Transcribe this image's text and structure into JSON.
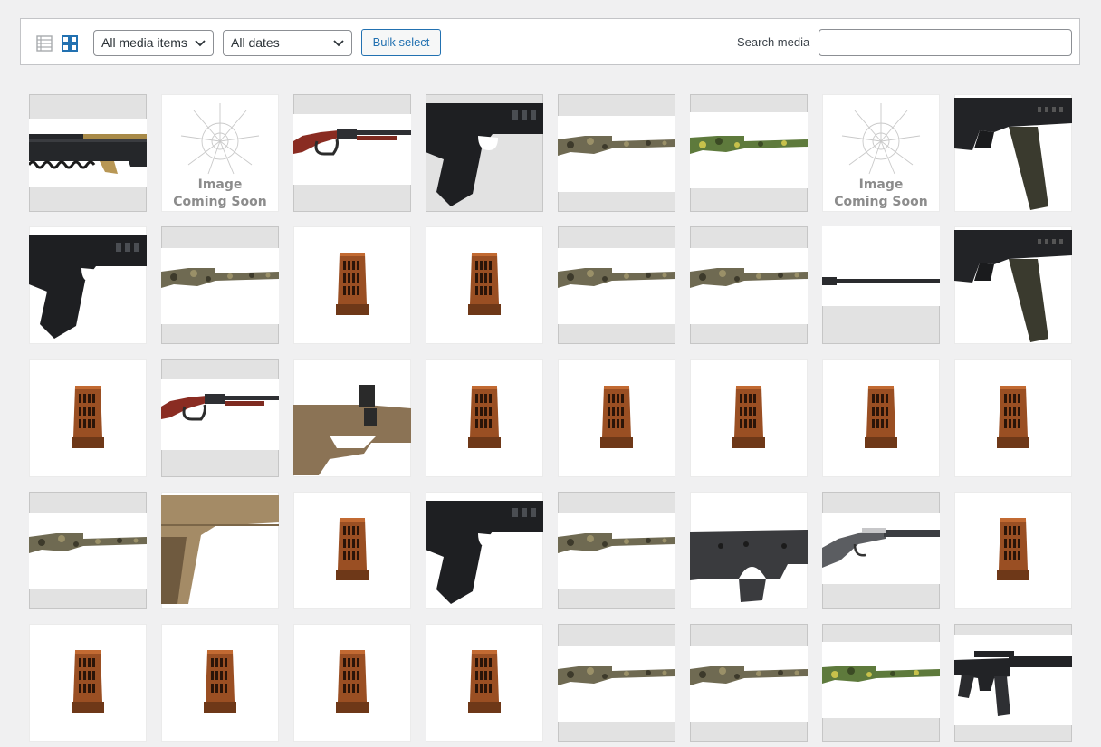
{
  "toolbar": {
    "filter_type": "All media items",
    "filter_date": "All dates",
    "bulk_select_label": "Bulk select",
    "search_label": "Search media",
    "search_value": "",
    "icons": {
      "list_view": "list-view-icon",
      "grid_view": "grid-view-icon",
      "dropdown": "chevron-down-icon"
    },
    "accent_color": "#2271b1"
  },
  "placeholder": {
    "line1": "Image",
    "line2": "Coming Soon"
  },
  "media_grid": {
    "rows": [
      [
        {
          "type": "slide-assembly",
          "bg": "gray"
        },
        {
          "type": "placeholder",
          "bg": "white"
        },
        {
          "type": "lever-rifle",
          "bg": "gray"
        },
        {
          "type": "pistol-black",
          "bg": "gray"
        },
        {
          "type": "camo-shotgun",
          "bg": "gray"
        },
        {
          "type": "camo-shotgun-green",
          "bg": "gray"
        },
        {
          "type": "placeholder",
          "bg": "white"
        },
        {
          "type": "pcc-black",
          "bg": "white"
        }
      ],
      [
        {
          "type": "pistol-black",
          "bg": "white"
        },
        {
          "type": "camo-shotgun",
          "bg": "gray"
        },
        {
          "type": "muzzle-brake",
          "bg": "white"
        },
        {
          "type": "muzzle-brake",
          "bg": "white"
        },
        {
          "type": "camo-shotgun",
          "bg": "gray"
        },
        {
          "type": "camo-shotgun",
          "bg": "gray"
        },
        {
          "type": "barrel",
          "bg": "gray"
        },
        {
          "type": "pcc-black",
          "bg": "white"
        }
      ],
      [
        {
          "type": "muzzle-brake",
          "bg": "white"
        },
        {
          "type": "lever-rifle",
          "bg": "gray"
        },
        {
          "type": "tan-lower",
          "bg": "white"
        },
        {
          "type": "muzzle-brake",
          "bg": "white"
        },
        {
          "type": "muzzle-brake",
          "bg": "white"
        },
        {
          "type": "muzzle-brake",
          "bg": "white"
        },
        {
          "type": "muzzle-brake",
          "bg": "white"
        },
        {
          "type": "muzzle-brake",
          "bg": "white"
        }
      ],
      [
        {
          "type": "camo-shotgun",
          "bg": "gray"
        },
        {
          "type": "tan-1911",
          "bg": "white"
        },
        {
          "type": "muzzle-brake",
          "bg": "white"
        },
        {
          "type": "pistol-black",
          "bg": "white"
        },
        {
          "type": "camo-shotgun",
          "bg": "gray"
        },
        {
          "type": "black-lower",
          "bg": "white"
        },
        {
          "type": "gray-rifle",
          "bg": "gray"
        },
        {
          "type": "muzzle-brake",
          "bg": "white"
        }
      ],
      [
        {
          "type": "muzzle-brake",
          "bg": "white"
        },
        {
          "type": "muzzle-brake",
          "bg": "white"
        },
        {
          "type": "muzzle-brake",
          "bg": "white"
        },
        {
          "type": "muzzle-brake",
          "bg": "white"
        },
        {
          "type": "camo-shotgun",
          "bg": "gray"
        },
        {
          "type": "camo-shotgun",
          "bg": "gray"
        },
        {
          "type": "camo-shotgun-green",
          "bg": "gray"
        },
        {
          "type": "ar15-black",
          "bg": "gray"
        }
      ]
    ]
  }
}
